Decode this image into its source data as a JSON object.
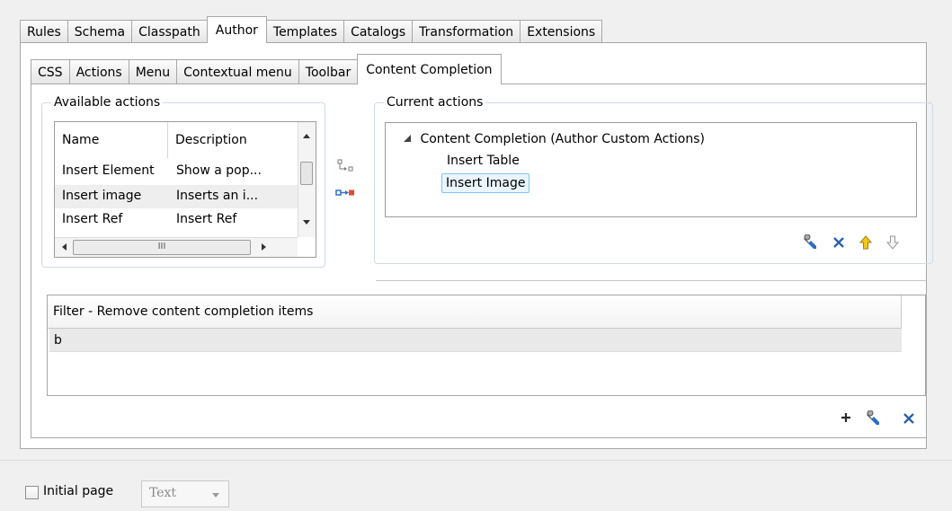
{
  "top_tabs": [
    "Rules",
    "Schema",
    "Classpath",
    "Author",
    "Templates",
    "Catalogs",
    "Transformation",
    "Extensions"
  ],
  "top_active": "Author",
  "sub_tabs": [
    "CSS",
    "Actions",
    "Menu",
    "Contextual menu",
    "Toolbar",
    "Content Completion"
  ],
  "sub_active": "Content Completion",
  "available": {
    "legend": "Available actions",
    "col_name": "Name",
    "col_desc": "Description",
    "rows": [
      {
        "name": "Insert Element",
        "desc": "Show a pop..."
      },
      {
        "name": "Insert image",
        "desc": "Inserts an i..."
      },
      {
        "name": "Insert Ref",
        "desc": "Insert Ref"
      }
    ],
    "hscroll_grip": "III"
  },
  "current": {
    "legend": "Current actions",
    "root": "Content Completion (Author Custom Actions)",
    "children": [
      "Insert Table",
      "Insert Image"
    ],
    "selected": "Insert Image"
  },
  "filter": {
    "header": "Filter - Remove content completion items",
    "rows": [
      "b"
    ]
  },
  "bottom": {
    "initial_page_label": "Initial page",
    "initial_page_checked": false,
    "select_value": "Text"
  },
  "icons": {
    "add_arrow": "add-to-current-icon",
    "remove_arrow": "remove-from-current-icon",
    "edit": "wrench-icon",
    "delete": "x-icon",
    "up": "arrow-up-icon",
    "down": "arrow-down-icon",
    "plus": "plus-icon"
  },
  "colors": {
    "delete_blue": "#2c5fa8",
    "up_yellow": "#f3c619",
    "selection_border": "#7ec3f0"
  }
}
